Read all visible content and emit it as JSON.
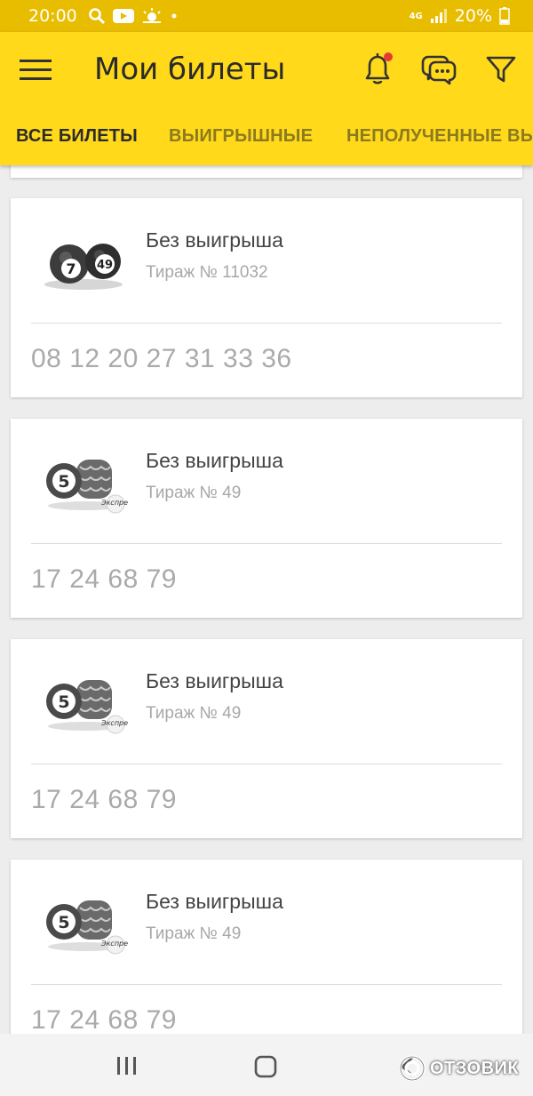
{
  "status_bar": {
    "time": "20:00",
    "network": "4G",
    "battery": "20%",
    "icons": [
      "search-icon",
      "youtube-icon",
      "weather-icon",
      "dot-icon",
      "signal-icon",
      "battery-icon"
    ]
  },
  "app_bar": {
    "title": "Мои билеты",
    "background": "#ffd91a",
    "notification_dot_color": "#e53935"
  },
  "tabs": [
    {
      "label": "ВСЕ БИЛЕТЫ",
      "active": true
    },
    {
      "label": "ВЫИГРЫШНЫЕ",
      "active": false
    },
    {
      "label": "НЕПОЛУЧЕННЫЕ ВЫ",
      "active": false
    }
  ],
  "tickets": [
    {
      "logo": "7-49-lottery-logo",
      "status": "Без выигрыша",
      "draw": "Тираж № 11032",
      "numbers": "08 12 20 27 31 33 36"
    },
    {
      "logo": "5-36-express-lottery-logo",
      "status": "Без выигрыша",
      "draw": "Тираж № 49",
      "numbers": "17 24 68 79"
    },
    {
      "logo": "5-36-express-lottery-logo",
      "status": "Без выигрыша",
      "draw": "Тираж № 49",
      "numbers": "17 24 68 79"
    },
    {
      "logo": "5-36-express-lottery-logo",
      "status": "Без выигрыша",
      "draw": "Тираж № 49",
      "numbers": "17 24 68 79"
    }
  ],
  "watermark": {
    "text": "ОТЗОВИК"
  }
}
